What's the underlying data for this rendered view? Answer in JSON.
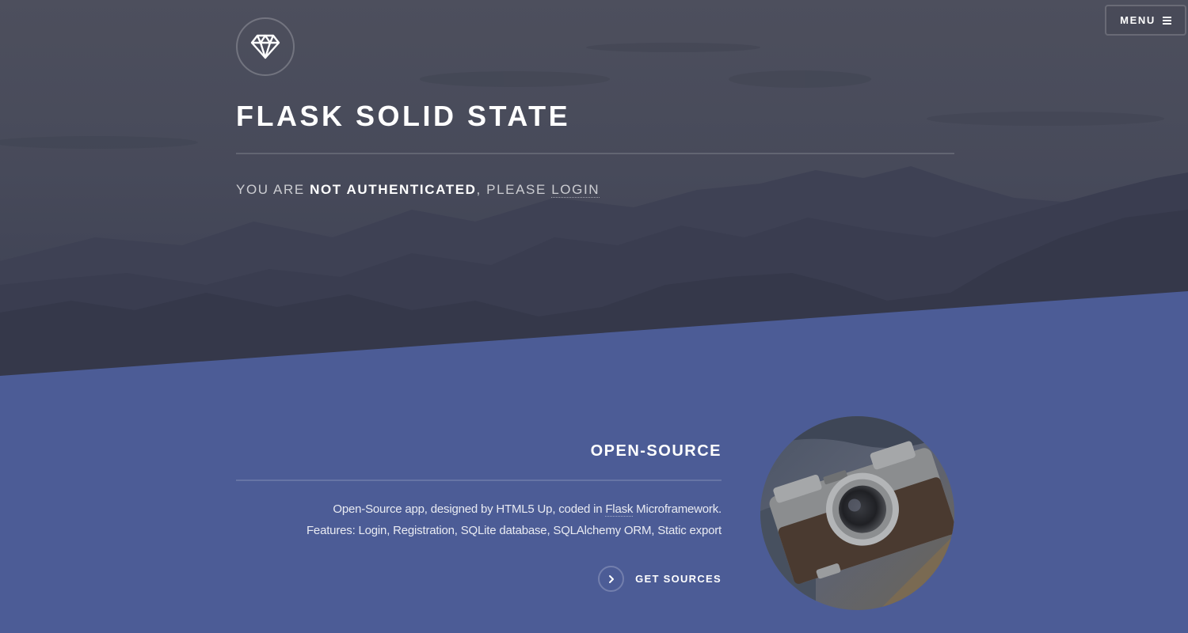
{
  "header": {
    "menu_label": "MENU",
    "menu_icon": "hamburger-icon",
    "logo_icon": "diamond-icon"
  },
  "banner": {
    "title": "FLASK SOLID STATE",
    "auth_prefix": "YOU ARE ",
    "auth_status": "NOT AUTHENTICATED",
    "auth_middle": ", PLEASE ",
    "auth_link": "LOGIN"
  },
  "feature": {
    "title": "OPEN-SOURCE",
    "line1_prefix": "Open-Source app, designed by HTML5 Up, coded in ",
    "line1_link": "Flask",
    "line1_suffix": " Microframework.",
    "line2": "Features: Login, Registration, SQLite database, SQLAlchemy ORM, Static export",
    "cta_label": "GET SOURCES",
    "cta_icon": "chevron-right-icon",
    "image": "camera-photo"
  },
  "colors": {
    "hero_dark": "#383c4e",
    "section_blue": "#4c5c96",
    "text_white": "#ffffff"
  }
}
